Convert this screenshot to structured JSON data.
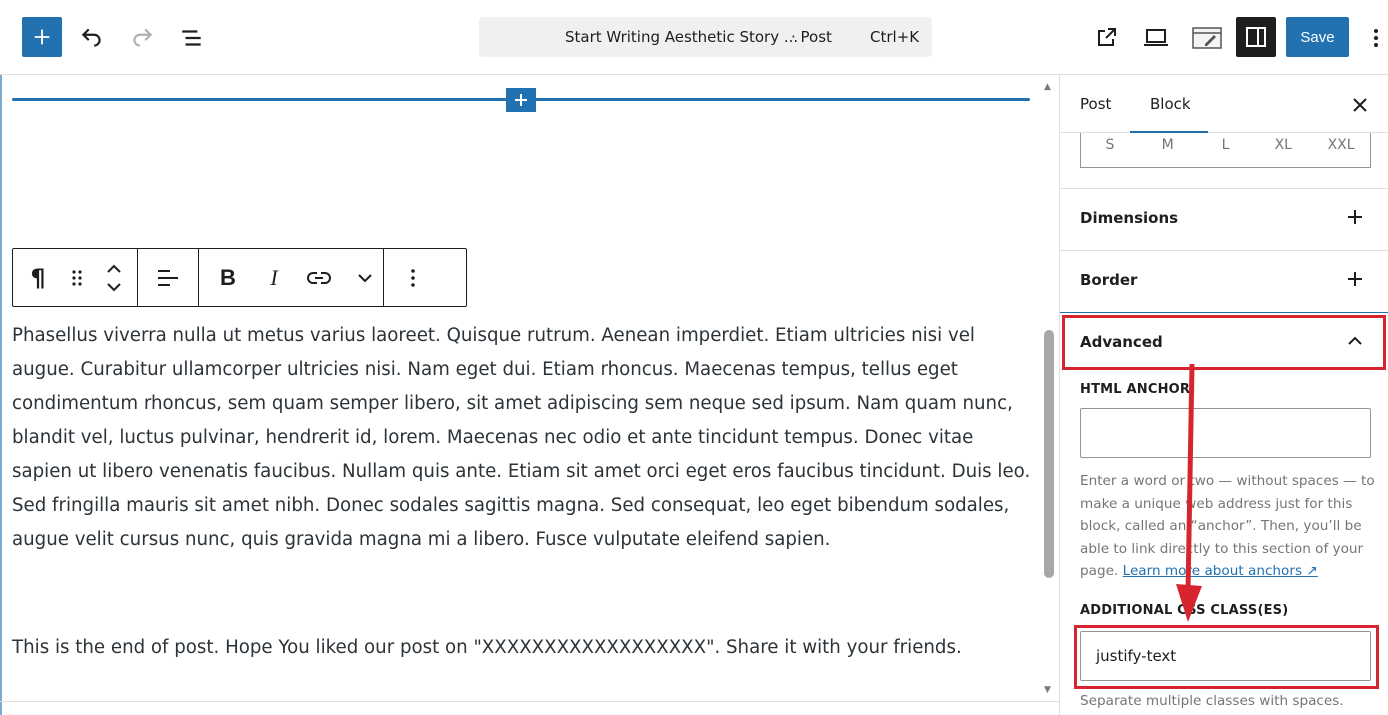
{
  "header": {
    "doc_title": "Start Writing Aesthetic Story ...",
    "doc_type": "· Post",
    "shortcut": "Ctrl+K",
    "save_label": "Save"
  },
  "toolbar_icons": {
    "add": "plus-icon",
    "undo": "undo-icon",
    "redo": "redo-icon",
    "list": "document-overview-icon",
    "view": "external-link-icon",
    "preview": "laptop-icon",
    "tools": "edit-tools-icon",
    "settings": "sidebar-settings-icon",
    "more": "more-vertical-icon"
  },
  "block_toolbar": {
    "paragraph_symbol": "¶",
    "bold_label": "B",
    "italic_label": "I"
  },
  "content": {
    "paragraph_1": "Phasellus viverra nulla ut metus varius laoreet. Quisque rutrum. Aenean imperdiet. Etiam ultricies nisi vel augue. Curabitur ullamcorper ultricies nisi. Nam eget dui. Etiam rhoncus. Maecenas tempus, tellus eget condimentum rhoncus, sem quam semper libero, sit amet adipiscing sem neque sed ipsum. Nam quam nunc, blandit vel, luctus pulvinar, hendrerit id, lorem. Maecenas nec odio et ante tincidunt tempus. Donec vitae sapien ut libero venenatis faucibus. Nullam quis ante. Etiam sit amet orci eget eros faucibus tincidunt. Duis leo. Sed fringilla mauris sit amet nibh. Donec sodales sagittis magna. Sed consequat, leo eget bibendum sodales, augue velit cursus nunc, quis gravida magna mi a libero. Fusce vulputate eleifend sapien.",
    "paragraph_2": "This is the end of post. Hope You liked our post on \"XXXXXXXXXXXXXXXXXX\". Share it with your friends."
  },
  "sidebar": {
    "tabs": [
      {
        "label": "Post"
      },
      {
        "label": "Block"
      }
    ],
    "active_tab": "Block",
    "sizes": [
      "S",
      "M",
      "L",
      "XL",
      "XXL"
    ],
    "panels": {
      "dimensions": "Dimensions",
      "border": "Border",
      "advanced": "Advanced"
    },
    "advanced": {
      "anchor_label": "HTML ANCHOR",
      "anchor_value": "",
      "anchor_help": "Enter a word or two — without spaces — to make a unique web address just for this block, called an “anchor”. Then, you’ll be able to link directly to this section of your page.",
      "anchor_link": "Learn more about anchors ↗",
      "css_label": "ADDITIONAL CSS CLASS(ES)",
      "css_value": "justify-text",
      "css_help": "Separate multiple classes with spaces."
    }
  },
  "annotation_colors": {
    "highlight": "#d6252f",
    "accent": "#2271b1"
  }
}
